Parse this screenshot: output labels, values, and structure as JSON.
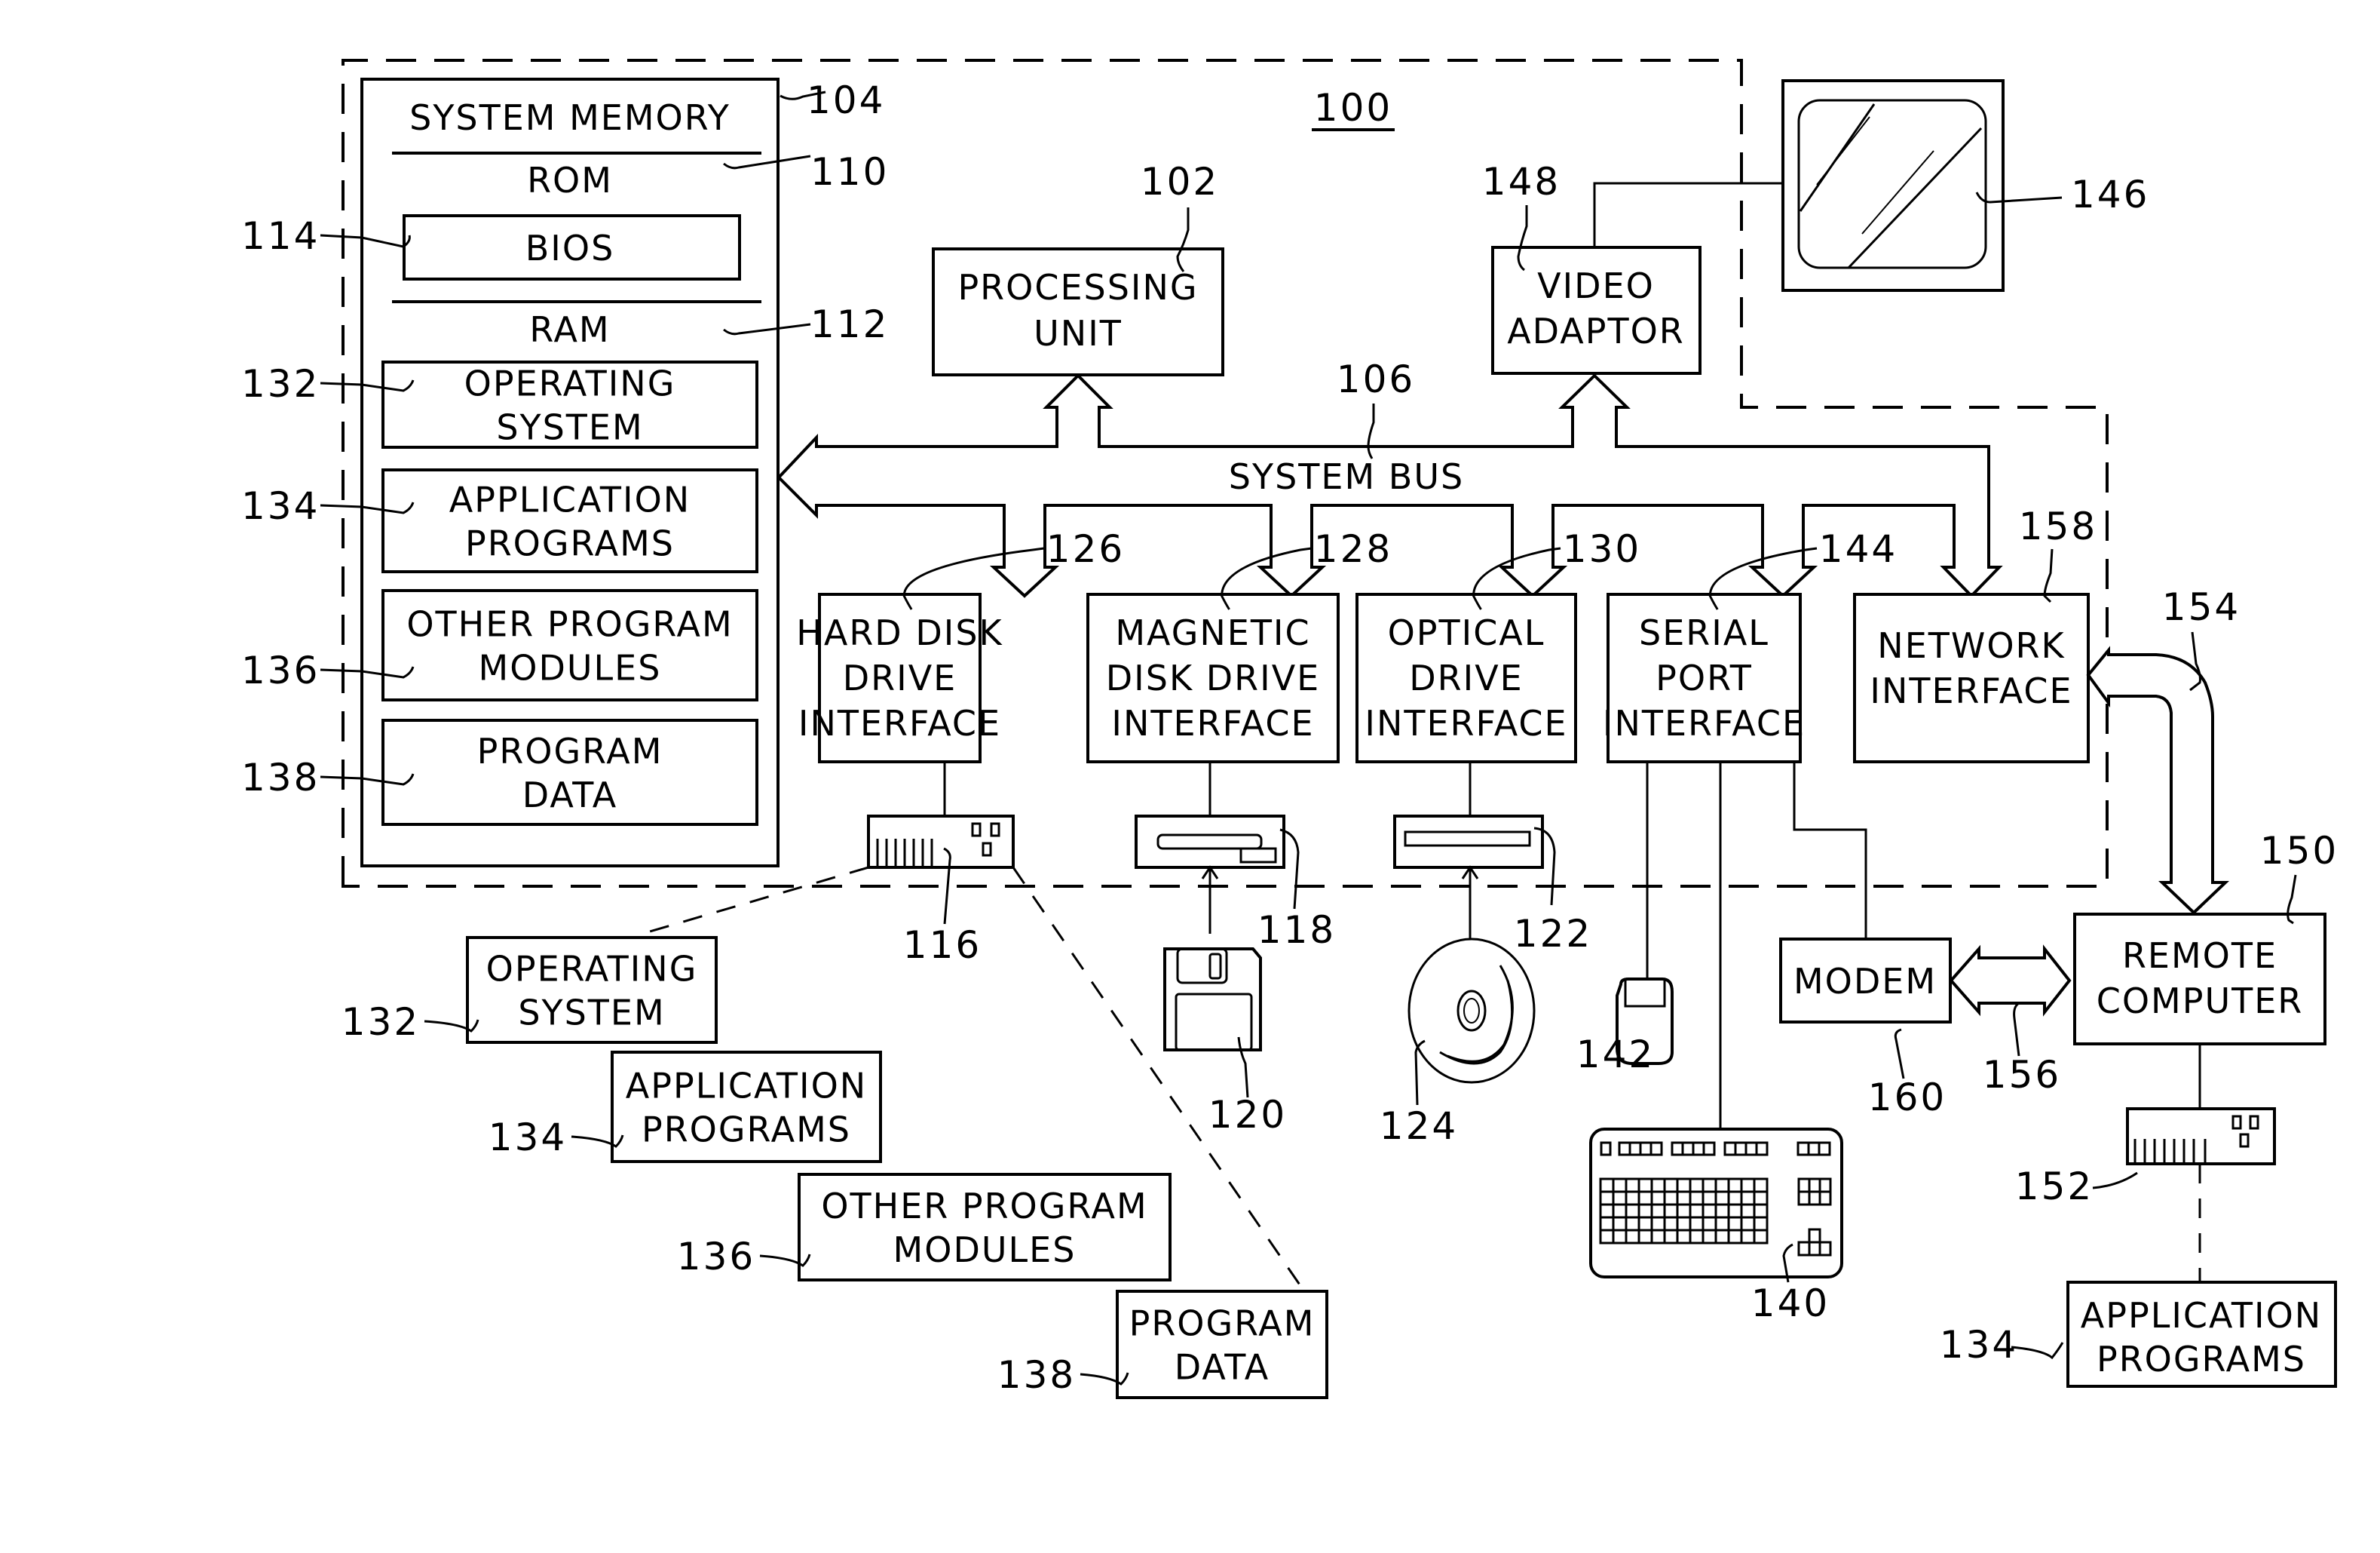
{
  "figure": {
    "system_ref": "100",
    "system_memory": {
      "ref": "104",
      "title": "SYSTEM MEMORY",
      "rom": {
        "label": "ROM",
        "ref": "110"
      },
      "bios": {
        "label": "BIOS",
        "ref": "114"
      },
      "ram": {
        "label": "RAM",
        "ref": "112"
      },
      "modules": [
        {
          "lines": [
            "OPERATING",
            "SYSTEM"
          ],
          "ref": "132"
        },
        {
          "lines": [
            "APPLICATION",
            "PROGRAMS"
          ],
          "ref": "134"
        },
        {
          "lines": [
            "OTHER  PROGRAM",
            "MODULES"
          ],
          "ref": "136"
        },
        {
          "lines": [
            "PROGRAM",
            "DATA"
          ],
          "ref": "138"
        }
      ]
    },
    "processing_unit": {
      "lines": [
        "PROCESSING",
        "UNIT"
      ],
      "ref": "102"
    },
    "video_adaptor": {
      "lines": [
        "VIDEO",
        "ADAPTOR"
      ],
      "ref": "148"
    },
    "monitor": {
      "ref": "146"
    },
    "system_bus": {
      "label": "SYSTEM  BUS",
      "ref": "106"
    },
    "interfaces": [
      {
        "lines": [
          "HARD  DISK",
          "DRIVE",
          "INTERFACE"
        ],
        "ref": "126"
      },
      {
        "lines": [
          "MAGNETIC",
          "DISK  DRIVE",
          "INTERFACE"
        ],
        "ref": "128"
      },
      {
        "lines": [
          "OPTICAL",
          "DRIVE",
          "INTERFACE"
        ],
        "ref": "130"
      },
      {
        "lines": [
          "SERIAL",
          "PORT",
          "INTERFACE"
        ],
        "ref": "144"
      },
      {
        "lines": [
          "NETWORK",
          "INTERFACE"
        ],
        "ref": "158"
      }
    ],
    "devices": {
      "hard_disk": {
        "ref": "116"
      },
      "floppy_drive": {
        "ref": "118"
      },
      "floppy_disk": {
        "ref": "120"
      },
      "optical_drive": {
        "ref": "122"
      },
      "optical_disc": {
        "ref": "124"
      },
      "mouse": {
        "ref": "142"
      },
      "keyboard": {
        "ref": "140"
      },
      "modem": {
        "label": "MODEM",
        "ref": "160"
      },
      "remote_storage": {
        "ref": "152"
      }
    },
    "links": {
      "lan": {
        "ref": "154"
      },
      "wan": {
        "ref": "156"
      }
    },
    "remote_computer": {
      "lines": [
        "REMOTE",
        "COMPUTER"
      ],
      "ref": "150"
    },
    "remote_app": {
      "lines": [
        "APPLICATION",
        "PROGRAMS"
      ],
      "ref": "134"
    },
    "stored_modules": [
      {
        "lines": [
          "OPERATING",
          "SYSTEM"
        ],
        "ref": "132"
      },
      {
        "lines": [
          "APPLICATION",
          "PROGRAMS"
        ],
        "ref": "134"
      },
      {
        "lines": [
          "OTHER  PROGRAM",
          "MODULES"
        ],
        "ref": "136"
      },
      {
        "lines": [
          "PROGRAM",
          "DATA"
        ],
        "ref": "138"
      }
    ]
  }
}
